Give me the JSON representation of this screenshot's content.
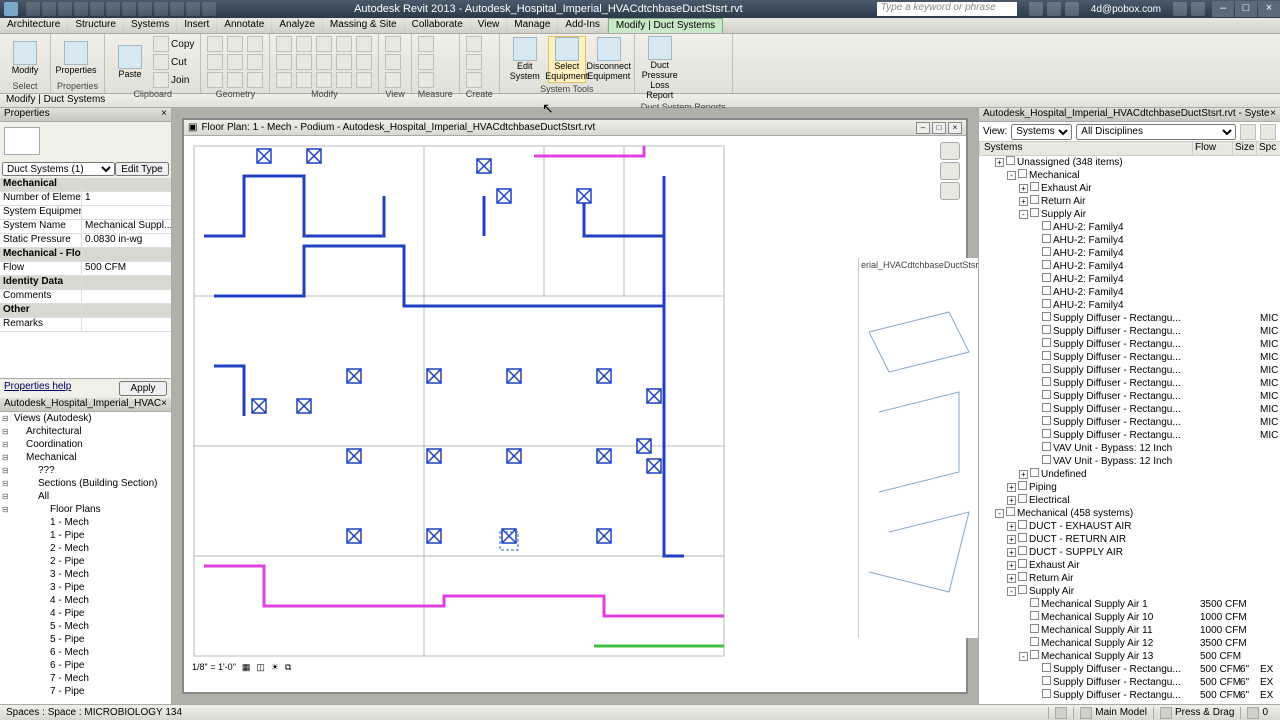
{
  "app": {
    "title": "Autodesk Revit 2013 - Autodesk_Hospital_Imperial_HVACdtchbaseDuctStsrt.rvt",
    "search_placeholder": "Type a keyword or phrase",
    "user": "4d@pobox.com"
  },
  "tabs": [
    "Architecture",
    "Structure",
    "Systems",
    "Insert",
    "Annotate",
    "Analyze",
    "Massing & Site",
    "Collaborate",
    "View",
    "Manage",
    "Add-Ins",
    "Modify | Duct Systems"
  ],
  "active_tab": 11,
  "ribbon": {
    "groups": [
      {
        "label": "Select",
        "big": [
          {
            "name": "Modify"
          }
        ]
      },
      {
        "label": "Properties",
        "big": [
          {
            "name": "Properties"
          }
        ]
      },
      {
        "label": "Clipboard",
        "big": [
          {
            "name": "Paste"
          }
        ],
        "small": [
          "Copy",
          "Cut",
          "Join"
        ]
      },
      {
        "label": "Geometry",
        "cols": 3
      },
      {
        "label": "Modify",
        "cols": 5
      },
      {
        "label": "View",
        "cols": 1
      },
      {
        "label": "Measure",
        "cols": 1
      },
      {
        "label": "Create",
        "cols": 1
      },
      {
        "label": "System Tools",
        "big": [
          {
            "name": "Edit System"
          },
          {
            "name": "Select Equipment",
            "sel": true
          },
          {
            "name": "Disconnect Equipment"
          }
        ]
      },
      {
        "label": "Duct System Reports",
        "big": [
          {
            "name": "Duct Pressure Loss Report"
          }
        ]
      }
    ]
  },
  "context_bar": "Modify | Duct Systems",
  "properties": {
    "title": "Properties",
    "type": "Duct Systems (1)",
    "edit_type": "Edit Type",
    "rows": [
      {
        "cat": true,
        "k": "Mechanical",
        "v": ""
      },
      {
        "k": "Number of Elements",
        "v": "1"
      },
      {
        "k": "System Equipment",
        "v": ""
      },
      {
        "k": "System Name",
        "v": "Mechanical Suppl..."
      },
      {
        "k": "Static Pressure",
        "v": "0.0830 in-wg"
      },
      {
        "cat": true,
        "k": "Mechanical - Flow",
        "v": ""
      },
      {
        "k": "Flow",
        "v": "500 CFM"
      },
      {
        "cat": true,
        "k": "Identity Data",
        "v": ""
      },
      {
        "k": "Comments",
        "v": ""
      },
      {
        "cat": true,
        "k": "Other",
        "v": ""
      },
      {
        "k": "Remarks",
        "v": ""
      }
    ],
    "help": "Properties help",
    "apply": "Apply"
  },
  "project_browser": {
    "title": "Autodesk_Hospital_Imperial_HVACdtchbaseDuctStsrt.rvt",
    "tree": [
      {
        "l": 1,
        "t": "Views (Autodesk)"
      },
      {
        "l": 2,
        "t": "Architectural"
      },
      {
        "l": 2,
        "t": "Coordination"
      },
      {
        "l": 2,
        "t": "Mechanical"
      },
      {
        "l": 3,
        "t": "???"
      },
      {
        "l": 3,
        "t": "Sections (Building Section)"
      },
      {
        "l": 3,
        "t": "All"
      },
      {
        "l": 4,
        "t": "Floor Plans"
      },
      {
        "l": 4,
        "t": "1 - Mech",
        "leaf": true
      },
      {
        "l": 4,
        "t": "1 - Pipe",
        "leaf": true
      },
      {
        "l": 4,
        "t": "2 - Mech",
        "leaf": true
      },
      {
        "l": 4,
        "t": "2 - Pipe",
        "leaf": true
      },
      {
        "l": 4,
        "t": "3 - Mech",
        "leaf": true
      },
      {
        "l": 4,
        "t": "3 - Pipe",
        "leaf": true
      },
      {
        "l": 4,
        "t": "4 - Mech",
        "leaf": true
      },
      {
        "l": 4,
        "t": "4 - Pipe",
        "leaf": true
      },
      {
        "l": 4,
        "t": "5 - Mech",
        "leaf": true
      },
      {
        "l": 4,
        "t": "5 - Pipe",
        "leaf": true
      },
      {
        "l": 4,
        "t": "6 - Mech",
        "leaf": true
      },
      {
        "l": 4,
        "t": "6 - Pipe",
        "leaf": true
      },
      {
        "l": 4,
        "t": "7 - Mech",
        "leaf": true
      },
      {
        "l": 4,
        "t": "7 - Pipe",
        "leaf": true
      }
    ]
  },
  "view": {
    "title": "Floor Plan: 1 - Mech - Podium - Autodesk_Hospital_Imperial_HVACdtchbaseDuctStsrt.rvt",
    "scale": "1/8\" = 1'-0\"",
    "view3d_label": "erial_HVACdtchbaseDuctStsrt.rvt"
  },
  "system_browser": {
    "title": "Autodesk_Hospital_Imperial_HVACdtchbaseDuctStsrt.rvt - System Browser",
    "view_label": "View:",
    "view_value": "Systems",
    "discipline": "All Disciplines",
    "cols": [
      "Systems",
      "Flow",
      "Size",
      "Spc"
    ],
    "tree": [
      {
        "l": 1,
        "t": "Unassigned (348 items)",
        "exp": "+"
      },
      {
        "l": 2,
        "t": "Mechanical",
        "exp": "-"
      },
      {
        "l": 3,
        "t": "Exhaust Air",
        "exp": "+"
      },
      {
        "l": 3,
        "t": "Return Air",
        "exp": "+"
      },
      {
        "l": 3,
        "t": "Supply Air",
        "exp": "-"
      },
      {
        "l": 4,
        "t": "AHU-2: Family4"
      },
      {
        "l": 4,
        "t": "AHU-2: Family4"
      },
      {
        "l": 4,
        "t": "AHU-2: Family4"
      },
      {
        "l": 4,
        "t": "AHU-2: Family4"
      },
      {
        "l": 4,
        "t": "AHU-2: Family4"
      },
      {
        "l": 4,
        "t": "AHU-2: Family4"
      },
      {
        "l": 4,
        "t": "AHU-2: Family4"
      },
      {
        "l": 4,
        "t": "Supply Diffuser - Rectangu...",
        "spc": "MIC"
      },
      {
        "l": 4,
        "t": "Supply Diffuser - Rectangu...",
        "spc": "MIC"
      },
      {
        "l": 4,
        "t": "Supply Diffuser - Rectangu...",
        "spc": "MIC"
      },
      {
        "l": 4,
        "t": "Supply Diffuser - Rectangu...",
        "spc": "MIC"
      },
      {
        "l": 4,
        "t": "Supply Diffuser - Rectangu...",
        "spc": "MIC"
      },
      {
        "l": 4,
        "t": "Supply Diffuser - Rectangu...",
        "spc": "MIC"
      },
      {
        "l": 4,
        "t": "Supply Diffuser - Rectangu...",
        "spc": "MIC"
      },
      {
        "l": 4,
        "t": "Supply Diffuser - Rectangu...",
        "spc": "MIC"
      },
      {
        "l": 4,
        "t": "Supply Diffuser - Rectangu...",
        "spc": "MIC"
      },
      {
        "l": 4,
        "t": "Supply Diffuser - Rectangu...",
        "spc": "MIC"
      },
      {
        "l": 4,
        "t": "VAV Unit - Bypass: 12 Inch"
      },
      {
        "l": 4,
        "t": "VAV Unit - Bypass: 12 Inch"
      },
      {
        "l": 3,
        "t": "Undefined",
        "exp": "+"
      },
      {
        "l": 2,
        "t": "Piping",
        "exp": "+"
      },
      {
        "l": 2,
        "t": "Electrical",
        "exp": "+"
      },
      {
        "l": 1,
        "t": "Mechanical (458 systems)",
        "exp": "-"
      },
      {
        "l": 2,
        "t": "DUCT - EXHAUST AIR",
        "exp": "+"
      },
      {
        "l": 2,
        "t": "DUCT - RETURN AIR",
        "exp": "+"
      },
      {
        "l": 2,
        "t": "DUCT - SUPPLY AIR",
        "exp": "+"
      },
      {
        "l": 2,
        "t": "Exhaust Air",
        "exp": "+"
      },
      {
        "l": 2,
        "t": "Return Air",
        "exp": "+"
      },
      {
        "l": 2,
        "t": "Supply Air",
        "exp": "-"
      },
      {
        "l": 3,
        "t": "Mechanical Supply Air 1",
        "flow": "3500 CFM"
      },
      {
        "l": 3,
        "t": "Mechanical Supply Air 10",
        "flow": "1000 CFM"
      },
      {
        "l": 3,
        "t": "Mechanical Supply Air 11",
        "flow": "1000 CFM"
      },
      {
        "l": 3,
        "t": "Mechanical Supply Air 12",
        "flow": "3500 CFM"
      },
      {
        "l": 3,
        "t": "Mechanical Supply Air 13",
        "flow": "500 CFM",
        "exp": "-"
      },
      {
        "l": 4,
        "t": "Supply Diffuser - Rectangu...",
        "flow": "500 CFM",
        "size": "6\"",
        "spc": "EX"
      },
      {
        "l": 4,
        "t": "Supply Diffuser - Rectangu...",
        "flow": "500 CFM",
        "size": "6\"",
        "spc": "EX"
      },
      {
        "l": 4,
        "t": "Supply Diffuser - Rectangu...",
        "flow": "500 CFM",
        "size": "6\"",
        "spc": "EX"
      }
    ]
  },
  "status": {
    "left": "Spaces : Space : MICROBIOLOGY 134",
    "model": "Main Model",
    "drag": "Press & Drag"
  }
}
